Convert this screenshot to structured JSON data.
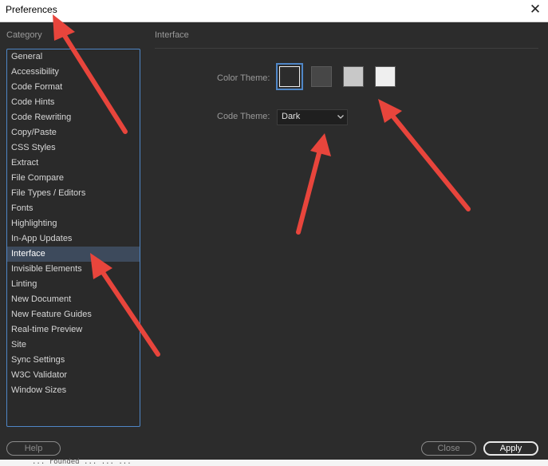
{
  "window": {
    "title": "Preferences",
    "close_glyph": "✕"
  },
  "sidebar": {
    "label": "Category",
    "selected": "Interface",
    "items": [
      "General",
      "Accessibility",
      "Code Format",
      "Code Hints",
      "Code Rewriting",
      "Copy/Paste",
      "CSS Styles",
      "Extract",
      "File Compare",
      "File Types / Editors",
      "Fonts",
      "Highlighting",
      "In-App Updates",
      "Interface",
      "Invisible Elements",
      "Linting",
      "New Document",
      "New Feature Guides",
      "Real-time Preview",
      "Site",
      "Sync Settings",
      "W3C Validator",
      "Window Sizes"
    ]
  },
  "panel": {
    "title": "Interface",
    "color_theme_label": "Color Theme:",
    "color_themes": [
      {
        "name": "darkest",
        "color": "#2c2c2c",
        "selected": true
      },
      {
        "name": "dark",
        "color": "#474747",
        "selected": false
      },
      {
        "name": "light",
        "color": "#c8c8c8",
        "selected": false
      },
      {
        "name": "lightest",
        "color": "#efefef",
        "selected": false
      }
    ],
    "code_theme_label": "Code Theme:",
    "code_theme_value": "Dark",
    "dropdown_icon": "chevron-down-icon"
  },
  "footer": {
    "help_label": "Help",
    "close_label": "Close",
    "apply_label": "Apply"
  },
  "bottom_strip": {
    "text": "... rounded ... ... ..."
  },
  "colors": {
    "background": "#2c2c2c",
    "accent": "#4f86c6",
    "annotation_arrow": "#e8453c"
  }
}
